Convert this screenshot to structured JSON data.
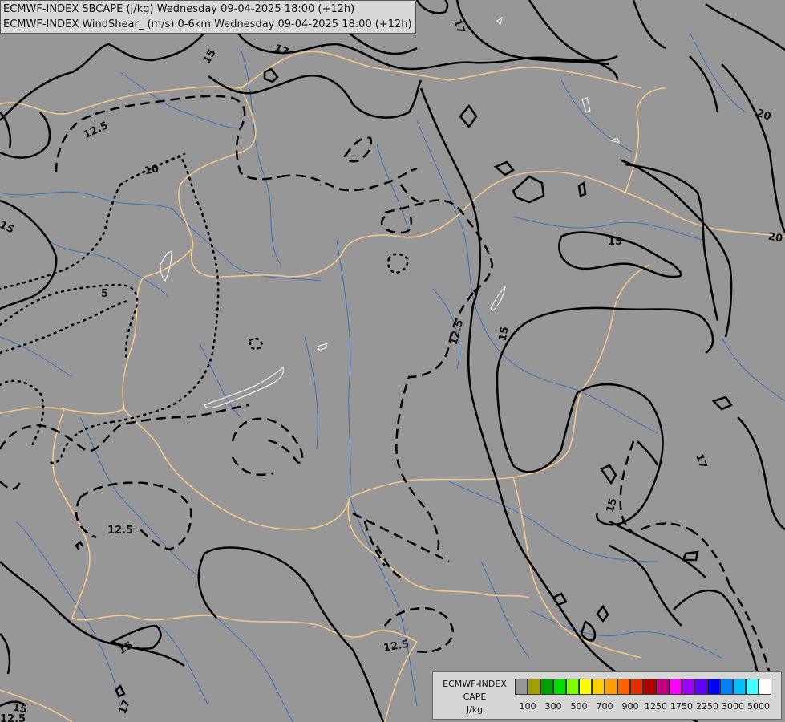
{
  "header": {
    "line1": "ECMWF-INDEX SBCAPE (J/kg) Wednesday 09-04-2025 18:00 (+12h)",
    "line2": "ECMWF-INDEX WindShear_ (m/s) 0-6km Wednesday 09-04-2025 18:00 (+12h)"
  },
  "map": {
    "background_color": "#979797",
    "border_color": "#f5c88c",
    "river_color": "#3a6fb5",
    "lake_outline_color": "#ffffff",
    "contour_color": "#000000",
    "contour_labels": [
      "15",
      "17",
      "20",
      "12.5",
      "10",
      "5",
      "15",
      "12.5",
      "15",
      "17",
      "15",
      "12.5",
      "15",
      "15",
      "17",
      "12.5",
      "20",
      "12.5",
      "17",
      "15"
    ]
  },
  "legend": {
    "title_line1": "ECMWF-INDEX",
    "title_line2": "CAPE",
    "title_line3": "J/kg",
    "colors": [
      "#979797",
      "#a0a000",
      "#00a000",
      "#00e000",
      "#80ff00",
      "#ffff00",
      "#ffd000",
      "#ffa000",
      "#ff6000",
      "#e03000",
      "#b00000",
      "#c00080",
      "#ff00ff",
      "#a000ff",
      "#6000ff",
      "#0000ff",
      "#0080ff",
      "#00c0ff",
      "#40ffff",
      "#ffffff"
    ],
    "tick_labels": [
      "100",
      "300",
      "500",
      "700",
      "900",
      "1250",
      "1750",
      "2250",
      "3000",
      "5000"
    ]
  }
}
